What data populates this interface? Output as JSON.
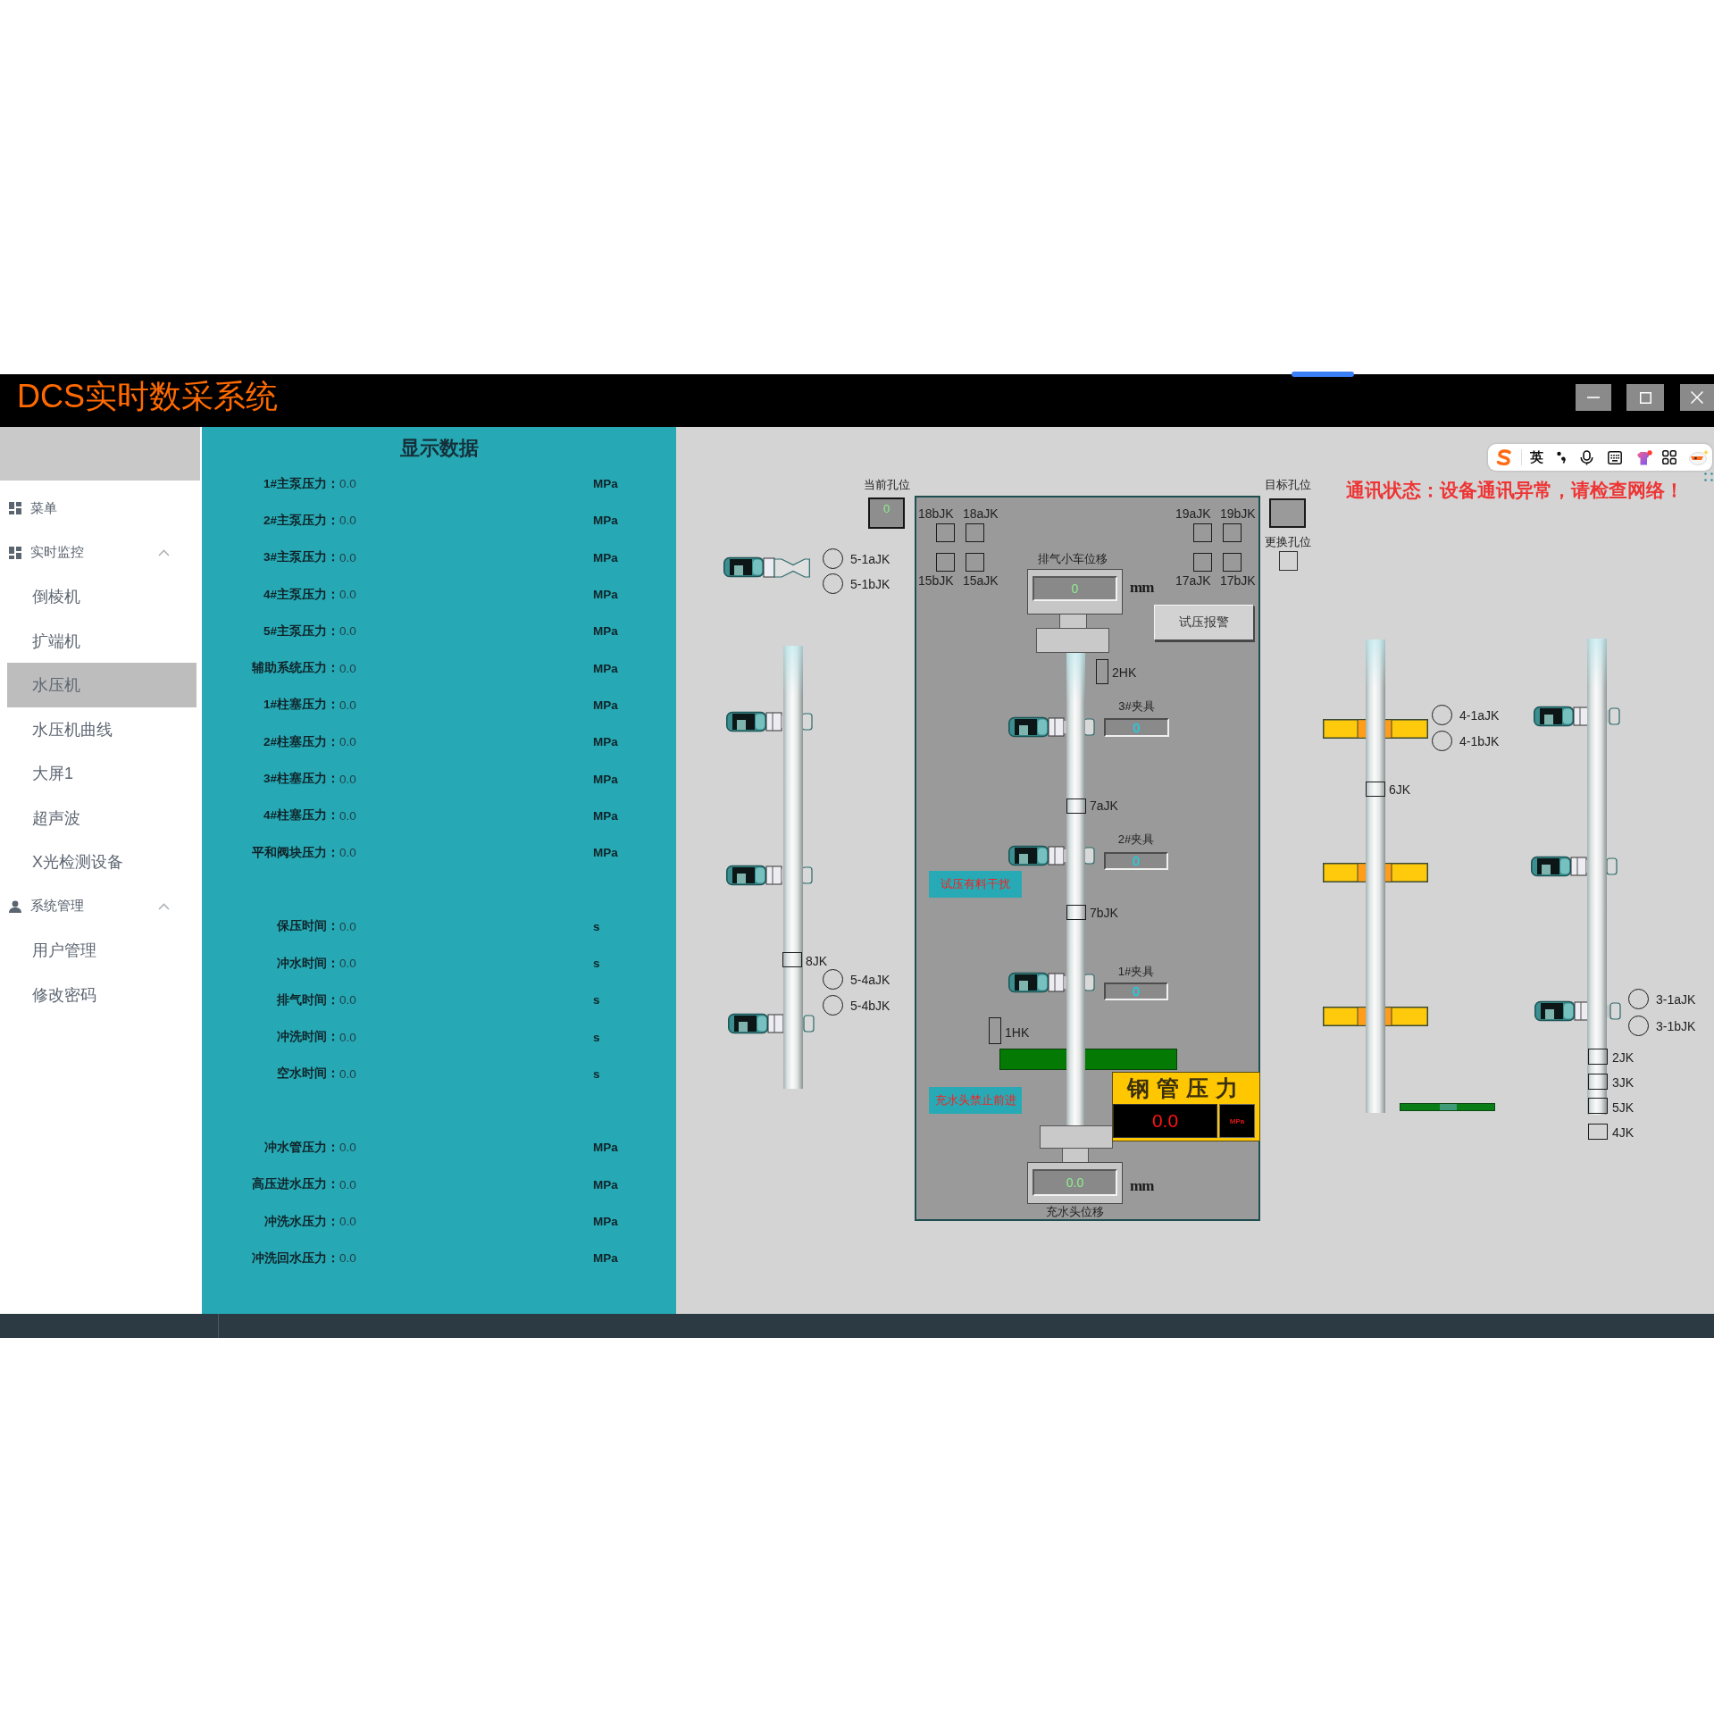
{
  "window": {
    "title": "DCS实时数采系统"
  },
  "sidebar": {
    "items": [
      {
        "kind": "heading",
        "label": "菜单"
      },
      {
        "kind": "group",
        "label": "实时监控",
        "expanded": true,
        "children": [
          {
            "label": "倒棱机",
            "selected": false
          },
          {
            "label": "扩端机",
            "selected": false
          },
          {
            "label": "水压机",
            "selected": true
          },
          {
            "label": "水压机曲线",
            "selected": false
          },
          {
            "label": "大屏1",
            "selected": false
          },
          {
            "label": "超声波",
            "selected": false
          },
          {
            "label": "X光检测设备",
            "selected": false
          }
        ]
      },
      {
        "kind": "group",
        "label": "系统管理",
        "expanded": true,
        "children": [
          {
            "label": "用户管理",
            "selected": false
          },
          {
            "label": "修改密码",
            "selected": false
          }
        ]
      }
    ]
  },
  "data_panel": {
    "title": "显示数据",
    "groups": [
      {
        "rows": [
          {
            "label": "1#主泵压力：",
            "value": "0.0",
            "unit": "MPa"
          },
          {
            "label": "2#主泵压力：",
            "value": "0.0",
            "unit": "MPa"
          },
          {
            "label": "3#主泵压力：",
            "value": "0.0",
            "unit": "MPa"
          },
          {
            "label": "4#主泵压力：",
            "value": "0.0",
            "unit": "MPa"
          },
          {
            "label": "5#主泵压力：",
            "value": "0.0",
            "unit": "MPa"
          },
          {
            "label": "辅助系统压力：",
            "value": "0.0",
            "unit": "MPa"
          },
          {
            "label": "1#柱塞压力：",
            "value": "0.0",
            "unit": "MPa"
          },
          {
            "label": "2#柱塞压力：",
            "value": "0.0",
            "unit": "MPa"
          },
          {
            "label": "3#柱塞压力：",
            "value": "0.0",
            "unit": "MPa"
          },
          {
            "label": "4#柱塞压力：",
            "value": "0.0",
            "unit": "MPa"
          },
          {
            "label": "平和阀块压力：",
            "value": "0.0",
            "unit": "MPa"
          }
        ]
      },
      {
        "rows": [
          {
            "label": "保压时间：",
            "value": "0.0",
            "unit": "s"
          },
          {
            "label": "冲水时间：",
            "value": "0.0",
            "unit": "s"
          },
          {
            "label": "排气时间：",
            "value": "0.0",
            "unit": "s"
          },
          {
            "label": "冲洗时间：",
            "value": "0.0",
            "unit": "s"
          },
          {
            "label": "空水时间：",
            "value": "0.0",
            "unit": "s"
          }
        ]
      },
      {
        "rows": [
          {
            "label": "冲水管压力：",
            "value": "0.0",
            "unit": "MPa"
          },
          {
            "label": "高压进水压力：",
            "value": "0.0",
            "unit": "MPa"
          },
          {
            "label": "冲洗水压力：",
            "value": "0.0",
            "unit": "MPa"
          },
          {
            "label": "冲洗回水压力：",
            "value": "0.0",
            "unit": "MPa"
          }
        ]
      }
    ]
  },
  "ime_toolbar": {
    "language": "英"
  },
  "monitor": {
    "current_hole": {
      "label": "当前孔位",
      "value": "0"
    },
    "target_hole": {
      "label": "目标孔位"
    },
    "change_hole": {
      "label": "更换孔位",
      "checked": false
    },
    "status_message": "通讯状态：设备通讯异常，请检查网络！",
    "sensors": [
      {
        "label": "18bJK",
        "on": false
      },
      {
        "label": "18aJK",
        "on": false
      },
      {
        "label": "15bJK",
        "on": false
      },
      {
        "label": "15aJK",
        "on": false
      },
      {
        "label": "19aJK",
        "on": false
      },
      {
        "label": "19bJK",
        "on": false
      },
      {
        "label": "17aJK",
        "on": false
      },
      {
        "label": "17bJK",
        "on": false
      },
      {
        "label": "8JK",
        "on": false
      },
      {
        "label": "7aJK",
        "on": false
      },
      {
        "label": "7bJK",
        "on": false
      },
      {
        "label": "6JK",
        "on": false
      },
      {
        "label": "2JK",
        "on": false
      },
      {
        "label": "3JK",
        "on": false
      },
      {
        "label": "5JK",
        "on": false
      },
      {
        "label": "4JK",
        "on": false
      }
    ],
    "lamps": [
      {
        "label": "5-1aJK",
        "on": false
      },
      {
        "label": "5-1bJK",
        "on": false
      },
      {
        "label": "5-4aJK",
        "on": false
      },
      {
        "label": "5-4bJK",
        "on": false
      },
      {
        "label": "4-1aJK",
        "on": false
      },
      {
        "label": "4-1bJK",
        "on": false
      },
      {
        "label": "3-1aJK",
        "on": false
      },
      {
        "label": "3-1bJK",
        "on": false
      }
    ],
    "exhaust_cart": {
      "label": "排气小车位移",
      "value": "0",
      "unit": "mm"
    },
    "alarm_button": "试压报警",
    "home_switches": [
      {
        "label": "2HK",
        "on": false
      },
      {
        "label": "1HK",
        "on": false
      }
    ],
    "clamps": [
      {
        "label": "3#夹具",
        "value": "0"
      },
      {
        "label": "2#夹具",
        "value": "0"
      },
      {
        "label": "1#夹具",
        "value": "0"
      }
    ],
    "alarms": [
      "试压有料干扰",
      "充水头禁止前进"
    ],
    "pipe_pressure": {
      "title": "钢管压力",
      "value": "0.0",
      "unit": "MPa"
    },
    "water_head": {
      "label": "充水头位移",
      "value": "0.0",
      "unit": "mm"
    }
  }
}
